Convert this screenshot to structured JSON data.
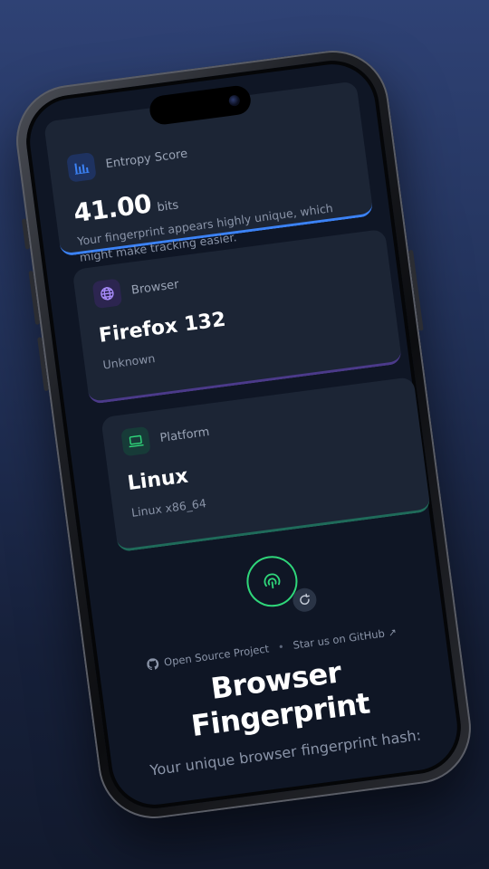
{
  "entropy": {
    "label": "Entropy Score",
    "value": "41.00",
    "unit": "bits",
    "description": "Your fingerprint appears highly unique, which might make tracking easier."
  },
  "browser": {
    "label": "Browser",
    "name": "Firefox 132",
    "detail": "Unknown"
  },
  "platform": {
    "label": "Platform",
    "name": "Linux",
    "detail": "Linux x86_64"
  },
  "links": {
    "open_source": "Open Source Project",
    "star": "Star us on GitHub"
  },
  "header": {
    "title": "Browser Fingerprint",
    "subtitle": "Your unique browser fingerprint hash:"
  },
  "colors": {
    "accent_blue": "#3b82f6",
    "accent_purple": "#a78bfa",
    "accent_green": "#2fd67a"
  },
  "icons": [
    "bar-chart-icon",
    "globe-icon",
    "laptop-icon",
    "fingerprint-icon",
    "refresh-icon",
    "github-icon",
    "external-arrow-icon"
  ]
}
